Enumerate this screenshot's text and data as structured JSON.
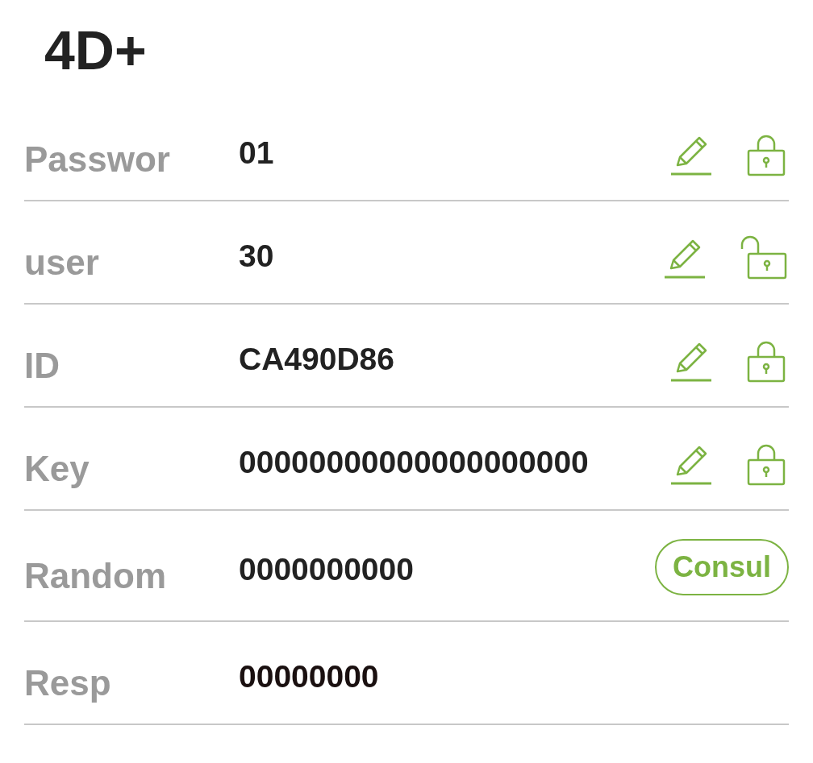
{
  "title": "4D+",
  "rows": [
    {
      "kind": "editable",
      "label": "Passwor",
      "value": "01",
      "locked": true
    },
    {
      "kind": "editable",
      "label": "user",
      "value": "30",
      "locked": false
    },
    {
      "kind": "editable",
      "label": "ID",
      "value": "CA490D86",
      "locked": true
    },
    {
      "kind": "editable",
      "label": "Key",
      "value": "00000000000000000000",
      "locked": true
    },
    {
      "kind": "query",
      "label": "Random",
      "value": "0000000000",
      "button": "Consul"
    },
    {
      "kind": "plain",
      "label": "Resp",
      "value": "00000000"
    }
  ]
}
